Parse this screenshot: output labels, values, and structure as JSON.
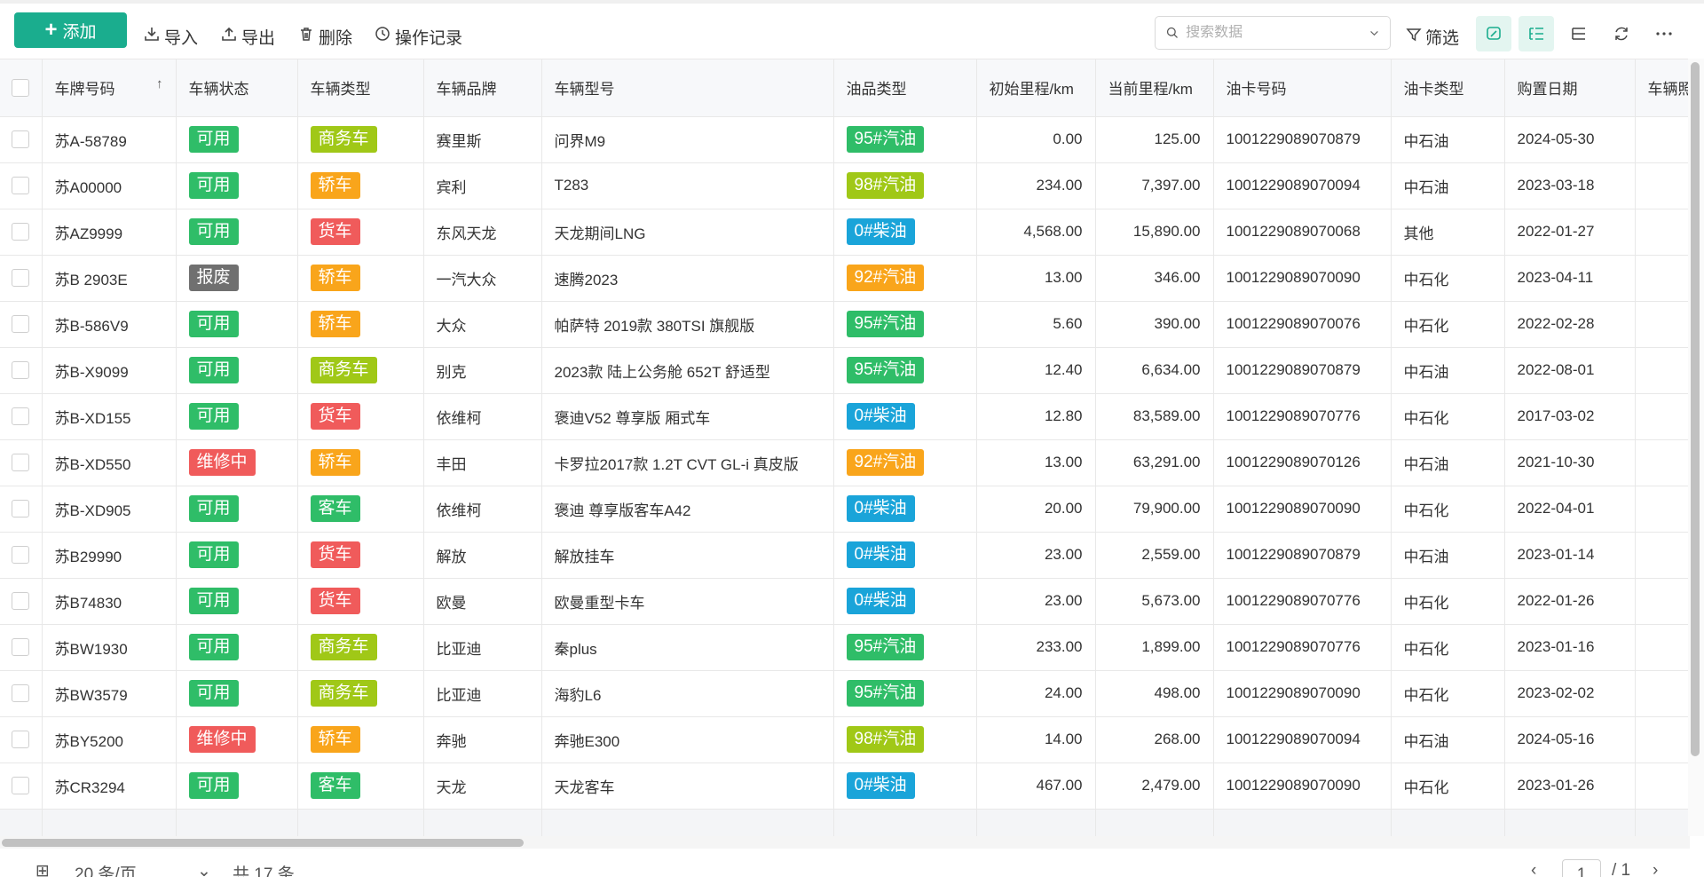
{
  "toolbar": {
    "add_label": "添加",
    "import_label": "导入",
    "export_label": "导出",
    "delete_label": "删除",
    "log_label": "操作记录",
    "search_placeholder": "搜索数据",
    "filter_label": "筛选"
  },
  "table": {
    "columns": [
      "车牌号码",
      "车辆状态",
      "车辆类型",
      "车辆品牌",
      "车辆型号",
      "油品类型",
      "初始里程/km",
      "当前里程/km",
      "油卡号码",
      "油卡类型",
      "购置日期",
      "车辆照片"
    ],
    "rows": [
      {
        "plate": "苏A-58789",
        "status": "可用",
        "type": "商务车",
        "brand": "赛里斯",
        "model": "问界M9",
        "fuel": "95#汽油",
        "init_km": "0.00",
        "cur_km": "125.00",
        "card": "1001229089070879",
        "card_type": "中石油",
        "date": "2024-05-30"
      },
      {
        "plate": "苏A00000",
        "status": "可用",
        "type": "轿车",
        "brand": "宾利",
        "model": "T283",
        "fuel": "98#汽油",
        "init_km": "234.00",
        "cur_km": "7,397.00",
        "card": "1001229089070094",
        "card_type": "中石油",
        "date": "2023-03-18"
      },
      {
        "plate": "苏AZ9999",
        "status": "可用",
        "type": "货车",
        "brand": "东风天龙",
        "model": "天龙期间LNG",
        "fuel": "0#柴油",
        "init_km": "4,568.00",
        "cur_km": "15,890.00",
        "card": "1001229089070068",
        "card_type": "其他",
        "date": "2022-01-27"
      },
      {
        "plate": "苏B 2903E",
        "status": "报废",
        "type": "轿车",
        "brand": "一汽大众",
        "model": "速腾2023",
        "fuel": "92#汽油",
        "init_km": "13.00",
        "cur_km": "346.00",
        "card": "1001229089070090",
        "card_type": "中石化",
        "date": "2023-04-11"
      },
      {
        "plate": "苏B-586V9",
        "status": "可用",
        "type": "轿车",
        "brand": "大众",
        "model": "帕萨特 2019款 380TSI 旗舰版",
        "fuel": "95#汽油",
        "init_km": "5.60",
        "cur_km": "390.00",
        "card": "1001229089070076",
        "card_type": "中石化",
        "date": "2022-02-28"
      },
      {
        "plate": "苏B-X9099",
        "status": "可用",
        "type": "商务车",
        "brand": "别克",
        "model": "2023款 陆上公务舱 652T 舒适型",
        "fuel": "95#汽油",
        "init_km": "12.40",
        "cur_km": "6,634.00",
        "card": "1001229089070879",
        "card_type": "中石油",
        "date": "2022-08-01"
      },
      {
        "plate": "苏B-XD155",
        "status": "可用",
        "type": "货车",
        "brand": "依维柯",
        "model": "褒迪V52 尊享版 厢式车",
        "fuel": "0#柴油",
        "init_km": "12.80",
        "cur_km": "83,589.00",
        "card": "1001229089070776",
        "card_type": "中石化",
        "date": "2017-03-02"
      },
      {
        "plate": "苏B-XD550",
        "status": "维修中",
        "type": "轿车",
        "brand": "丰田",
        "model": "卡罗拉2017款 1.2T CVT GL-i 真皮版",
        "fuel": "92#汽油",
        "init_km": "13.00",
        "cur_km": "63,291.00",
        "card": "1001229089070126",
        "card_type": "中石油",
        "date": "2021-10-30"
      },
      {
        "plate": "苏B-XD905",
        "status": "可用",
        "type": "客车",
        "brand": "依维柯",
        "model": "褒迪 尊享版客车A42",
        "fuel": "0#柴油",
        "init_km": "20.00",
        "cur_km": "79,900.00",
        "card": "1001229089070090",
        "card_type": "中石化",
        "date": "2022-04-01"
      },
      {
        "plate": "苏B29990",
        "status": "可用",
        "type": "货车",
        "brand": "解放",
        "model": "解放挂车",
        "fuel": "0#柴油",
        "init_km": "23.00",
        "cur_km": "2,559.00",
        "card": "1001229089070879",
        "card_type": "中石油",
        "date": "2023-01-14"
      },
      {
        "plate": "苏B74830",
        "status": "可用",
        "type": "货车",
        "brand": "欧曼",
        "model": "欧曼重型卡车",
        "fuel": "0#柴油",
        "init_km": "23.00",
        "cur_km": "5,673.00",
        "card": "1001229089070776",
        "card_type": "中石化",
        "date": "2022-01-26"
      },
      {
        "plate": "苏BW1930",
        "status": "可用",
        "type": "商务车",
        "brand": "比亚迪",
        "model": "秦plus",
        "fuel": "95#汽油",
        "init_km": "233.00",
        "cur_km": "1,899.00",
        "card": "1001229089070776",
        "card_type": "中石化",
        "date": "2023-01-16"
      },
      {
        "plate": "苏BW3579",
        "status": "可用",
        "type": "商务车",
        "brand": "比亚迪",
        "model": "海豹L6",
        "fuel": "95#汽油",
        "init_km": "24.00",
        "cur_km": "498.00",
        "card": "1001229089070090",
        "card_type": "中石化",
        "date": "2023-02-02"
      },
      {
        "plate": "苏BY5200",
        "status": "维修中",
        "type": "轿车",
        "brand": "奔驰",
        "model": "奔驰E300",
        "fuel": "98#汽油",
        "init_km": "14.00",
        "cur_km": "268.00",
        "card": "1001229089070094",
        "card_type": "中石油",
        "date": "2024-05-16"
      },
      {
        "plate": "苏CR3294",
        "status": "可用",
        "type": "客车",
        "brand": "天龙",
        "model": "天龙客车",
        "fuel": "0#柴油",
        "init_km": "467.00",
        "cur_km": "2,479.00",
        "card": "1001229089070090",
        "card_type": "中石化",
        "date": "2023-01-26"
      }
    ]
  },
  "tag_colors": {
    "可用": "#2fbd68",
    "报废": "#707070",
    "维修中": "#f05b5b",
    "商务车": "#a0c817",
    "轿车": "#f9a51b",
    "货车": "#f05b5b",
    "客车": "#2fbd68",
    "95#汽油": "#2fbd68",
    "98#汽油": "#a0c817",
    "0#柴油": "#1aa4d9",
    "92#汽油": "#f9a51b"
  },
  "pager": {
    "page_size": "20 条/页",
    "total": "共 17 条",
    "current_page": "1",
    "total_pages": "/ 1"
  }
}
